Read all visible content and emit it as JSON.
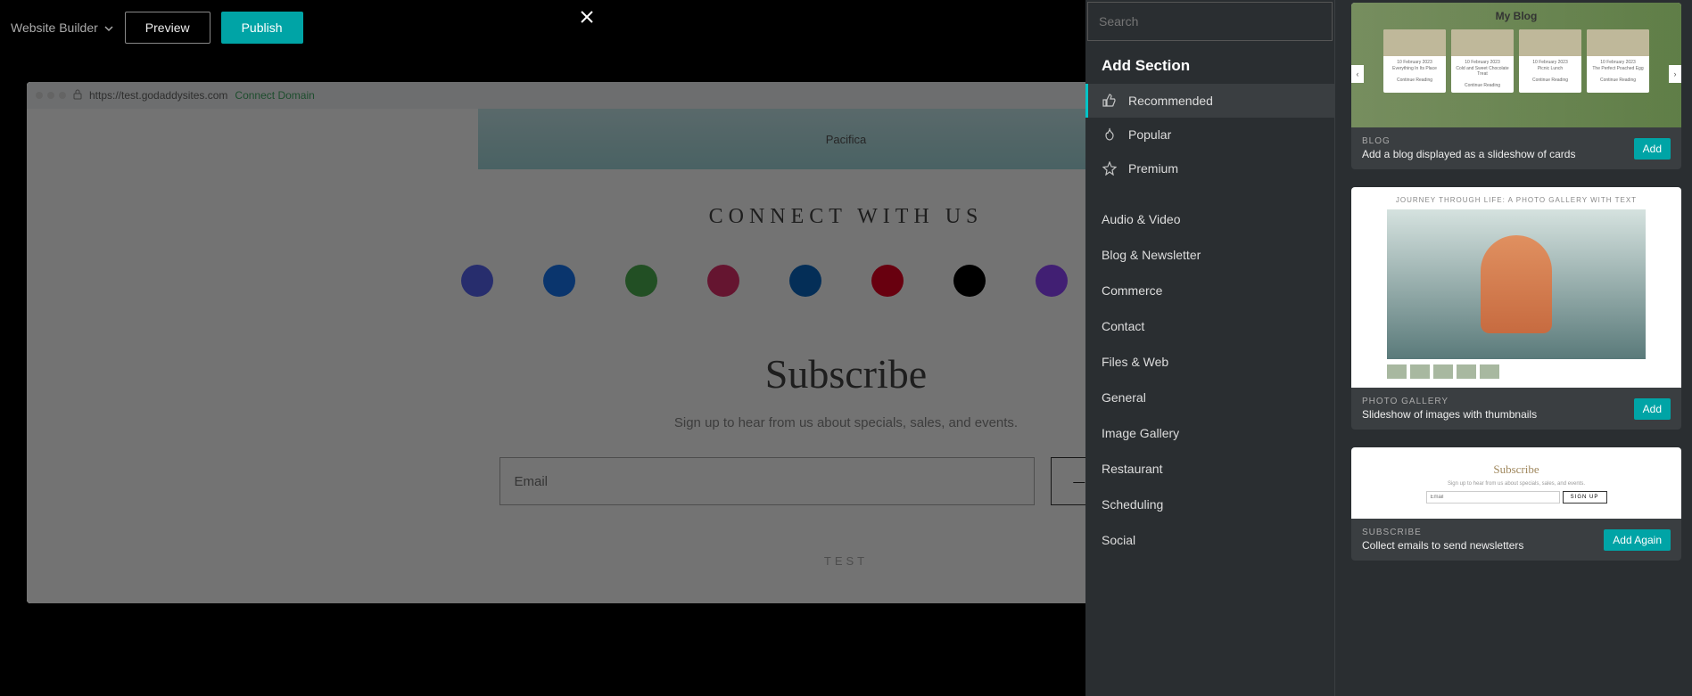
{
  "header": {
    "appTitle": "Website Builder",
    "preview": "Preview",
    "publish": "Publish"
  },
  "browser": {
    "url": "https://test.godaddysites.com",
    "connect": "Connect Domain"
  },
  "map": {
    "label": "Pacifica"
  },
  "page": {
    "connectTitle": "CONNECT WITH US",
    "subscribeTitle": "Subscribe",
    "subscribeSub": "Sign up to hear from us about specials, sales, and events.",
    "emailPlaceholder": "Email",
    "signup": "— SIGN UP —",
    "footer": "TEST"
  },
  "social": {
    "colors": [
      "#5865F2",
      "#1877F2",
      "#4CAF50",
      "#E1306C",
      "#0A66C2",
      "#E60023",
      "#000000",
      "#9146FF",
      "#000000",
      "#FF1A1A"
    ]
  },
  "panel": {
    "searchPlaceholder": "Search",
    "title": "Add Section",
    "tabs": [
      {
        "label": "Recommended",
        "icon": "thumb"
      },
      {
        "label": "Popular",
        "icon": "fire"
      },
      {
        "label": "Premium",
        "icon": "star"
      }
    ],
    "categories": [
      "Audio & Video",
      "Blog & Newsletter",
      "Commerce",
      "Contact",
      "Files & Web",
      "General",
      "Image Gallery",
      "Restaurant",
      "Scheduling",
      "Social"
    ]
  },
  "cards": {
    "blog": {
      "previewTitle": "My Blog",
      "posts": [
        {
          "date": "10 February 2023",
          "title": "Everything In Its Place"
        },
        {
          "date": "10 February 2023",
          "title": "Cold and Sweet Chocolate Treat"
        },
        {
          "date": "10 February 2023",
          "title": "Picnic Lunch"
        },
        {
          "date": "10 February 2023",
          "title": "The Perfect Poached Egg"
        }
      ],
      "readMore": "Continue Reading",
      "cat": "BLOG",
      "desc": "Add a blog displayed as a slideshow of cards",
      "btn": "Add"
    },
    "gallery": {
      "previewTitle": "JOURNEY THROUGH LIFE: A PHOTO GALLERY WITH TEXT",
      "cat": "PHOTO GALLERY",
      "desc": "Slideshow of images with thumbnails",
      "btn": "Add"
    },
    "subscribe": {
      "previewTitle": "Subscribe",
      "previewSub": "Sign up to hear from us about specials, sales, and events.",
      "previewEmail": "Email",
      "previewBtn": "SIGN UP",
      "cat": "SUBSCRIBE",
      "desc": "Collect emails to send newsletters",
      "btn": "Add Again"
    }
  }
}
